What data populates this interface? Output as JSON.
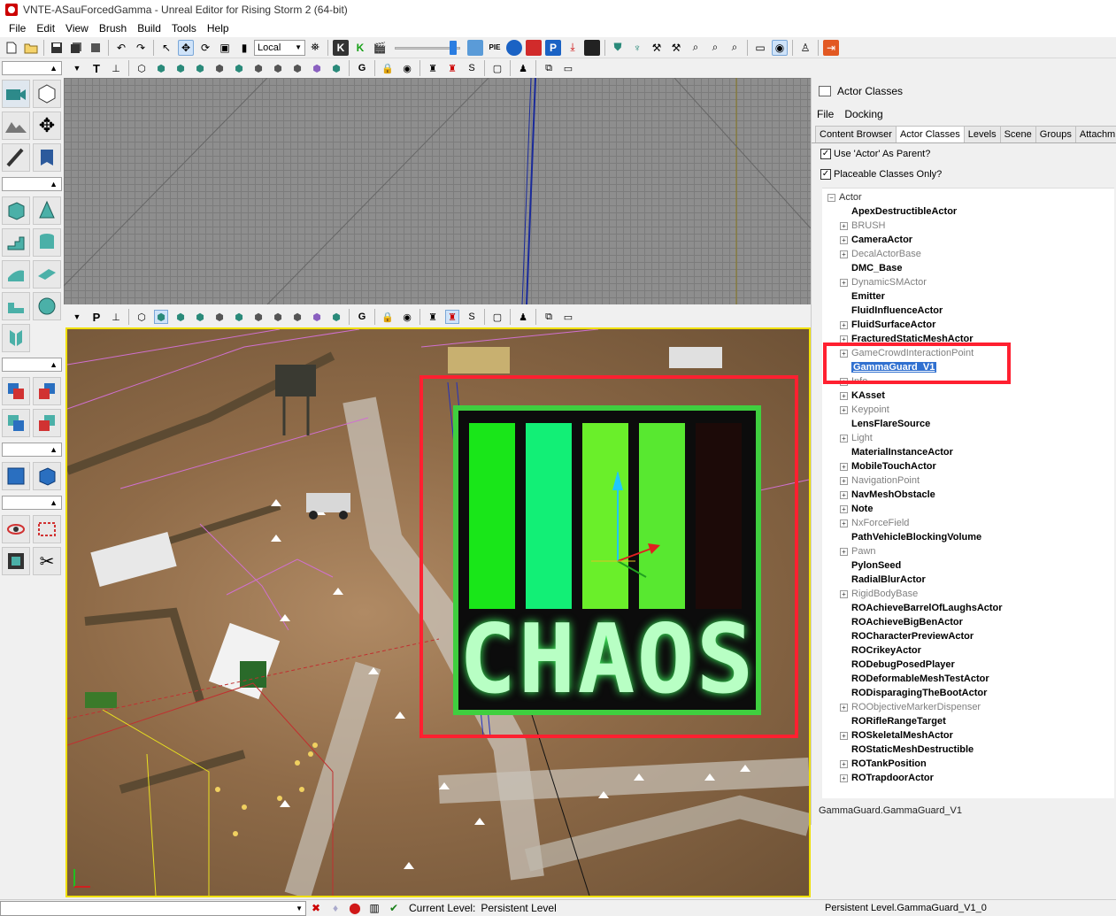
{
  "window": {
    "title": "VNTE-ASauForcedGamma - Unreal Editor for Rising Storm 2 (64-bit)"
  },
  "menu": [
    "File",
    "Edit",
    "View",
    "Brush",
    "Build",
    "Tools",
    "Help"
  ],
  "toolbar": {
    "coord_system": "Local"
  },
  "viewport_toolbar": {
    "top_mode_label": "T",
    "persp_mode_label": "P"
  },
  "overlay": {
    "logo_text": "CHAOS"
  },
  "actor_classes": {
    "title": "Actor Classes",
    "menu": [
      "File",
      "Docking"
    ],
    "tabs": [
      {
        "label": "Content Browser",
        "active": false
      },
      {
        "label": "Actor Classes",
        "active": true
      },
      {
        "label": "Levels",
        "active": false
      },
      {
        "label": "Scene",
        "active": false
      },
      {
        "label": "Groups",
        "active": false
      },
      {
        "label": "Attachm",
        "active": false
      }
    ],
    "checkboxes": [
      {
        "label": "Use 'Actor' As Parent?",
        "checked": true
      },
      {
        "label": "Placeable Classes Only?",
        "checked": true
      }
    ],
    "tree_root": "Actor",
    "items": [
      {
        "label": "ApexDestructibleActor",
        "expandable": false,
        "placeable": true
      },
      {
        "label": "BRUSH",
        "expandable": true,
        "placeable": false
      },
      {
        "label": "CameraActor",
        "expandable": true,
        "placeable": true
      },
      {
        "label": "DecalActorBase",
        "expandable": true,
        "placeable": false
      },
      {
        "label": "DMC_Base",
        "expandable": false,
        "placeable": true
      },
      {
        "label": "DynamicSMActor",
        "expandable": true,
        "placeable": false
      },
      {
        "label": "Emitter",
        "expandable": false,
        "placeable": true
      },
      {
        "label": "FluidInfluenceActor",
        "expandable": false,
        "placeable": true
      },
      {
        "label": "FluidSurfaceActor",
        "expandable": true,
        "placeable": true
      },
      {
        "label": "FracturedStaticMeshActor",
        "expandable": true,
        "placeable": true
      },
      {
        "label": "GameCrowdInteractionPoint",
        "expandable": true,
        "placeable": false
      },
      {
        "label": "GammaGuard_V1",
        "expandable": false,
        "placeable": true,
        "selected": true
      },
      {
        "label": "Info",
        "expandable": true,
        "placeable": false
      },
      {
        "label": "KAsset",
        "expandable": true,
        "placeable": true
      },
      {
        "label": "Keypoint",
        "expandable": true,
        "placeable": false
      },
      {
        "label": "LensFlareSource",
        "expandable": false,
        "placeable": true
      },
      {
        "label": "Light",
        "expandable": true,
        "placeable": false
      },
      {
        "label": "MaterialInstanceActor",
        "expandable": false,
        "placeable": true
      },
      {
        "label": "MobileTouchActor",
        "expandable": true,
        "placeable": true
      },
      {
        "label": "NavigationPoint",
        "expandable": true,
        "placeable": false
      },
      {
        "label": "NavMeshObstacle",
        "expandable": true,
        "placeable": true
      },
      {
        "label": "Note",
        "expandable": true,
        "placeable": true
      },
      {
        "label": "NxForceField",
        "expandable": true,
        "placeable": false
      },
      {
        "label": "PathVehicleBlockingVolume",
        "expandable": false,
        "placeable": true
      },
      {
        "label": "Pawn",
        "expandable": true,
        "placeable": false
      },
      {
        "label": "PylonSeed",
        "expandable": false,
        "placeable": true
      },
      {
        "label": "RadialBlurActor",
        "expandable": false,
        "placeable": true
      },
      {
        "label": "RigidBodyBase",
        "expandable": true,
        "placeable": false
      },
      {
        "label": "ROAchieveBarrelOfLaughsActor",
        "expandable": false,
        "placeable": true
      },
      {
        "label": "ROAchieveBigBenActor",
        "expandable": false,
        "placeable": true
      },
      {
        "label": "ROCharacterPreviewActor",
        "expandable": false,
        "placeable": true
      },
      {
        "label": "ROCrikeyActor",
        "expandable": false,
        "placeable": true
      },
      {
        "label": "RODebugPosedPlayer",
        "expandable": false,
        "placeable": true
      },
      {
        "label": "RODeformableMeshTestActor",
        "expandable": false,
        "placeable": true
      },
      {
        "label": "RODisparagingTheBootActor",
        "expandable": false,
        "placeable": true
      },
      {
        "label": "ROObjectiveMarkerDispenser",
        "expandable": true,
        "placeable": false
      },
      {
        "label": "RORifleRangeTarget",
        "expandable": false,
        "placeable": true
      },
      {
        "label": "ROSkeletalMeshActor",
        "expandable": true,
        "placeable": true
      },
      {
        "label": "ROStaticMeshDestructible",
        "expandable": false,
        "placeable": true
      },
      {
        "label": "ROTankPosition",
        "expandable": true,
        "placeable": true
      },
      {
        "label": "ROTrapdoorActor",
        "expandable": true,
        "placeable": true
      }
    ],
    "footer": "GammaGuard.GammaGuard_V1"
  },
  "status": {
    "current_level_label": "Current Level:",
    "current_level_value": "Persistent Level",
    "selection": "Persistent Level.GammaGuard_V1_0"
  },
  "colors": {
    "highlight_red": "#ff2030",
    "selection_blue": "#3070d0",
    "viewport_border": "#f0e000",
    "logo_green": "#00ff40"
  }
}
